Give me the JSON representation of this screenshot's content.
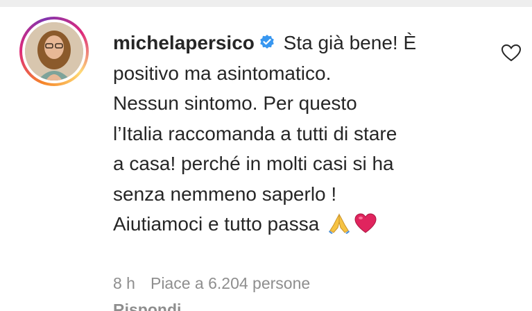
{
  "comment": {
    "username": "michelapersico",
    "verified": true,
    "text_lines": [
      "Sta già bene! È",
      "positivo ma asintomatico.",
      "Nessun sintomo. Per questo",
      "l’Italia raccomanda a tutti di stare",
      "a casa! perché in molti casi si ha",
      "senza nemmeno saperlo !",
      "Aiutiamoci e tutto passa"
    ],
    "emojis": [
      "folded-hands-icon",
      "red-heart-icon"
    ],
    "time": "8 h",
    "likes": "Piace a 6.204 persone",
    "reply": "Rispondi"
  },
  "colors": {
    "text": "#262626",
    "meta": "#8e8e8e",
    "verified": "#3897f0",
    "heart": "#e0245e"
  }
}
